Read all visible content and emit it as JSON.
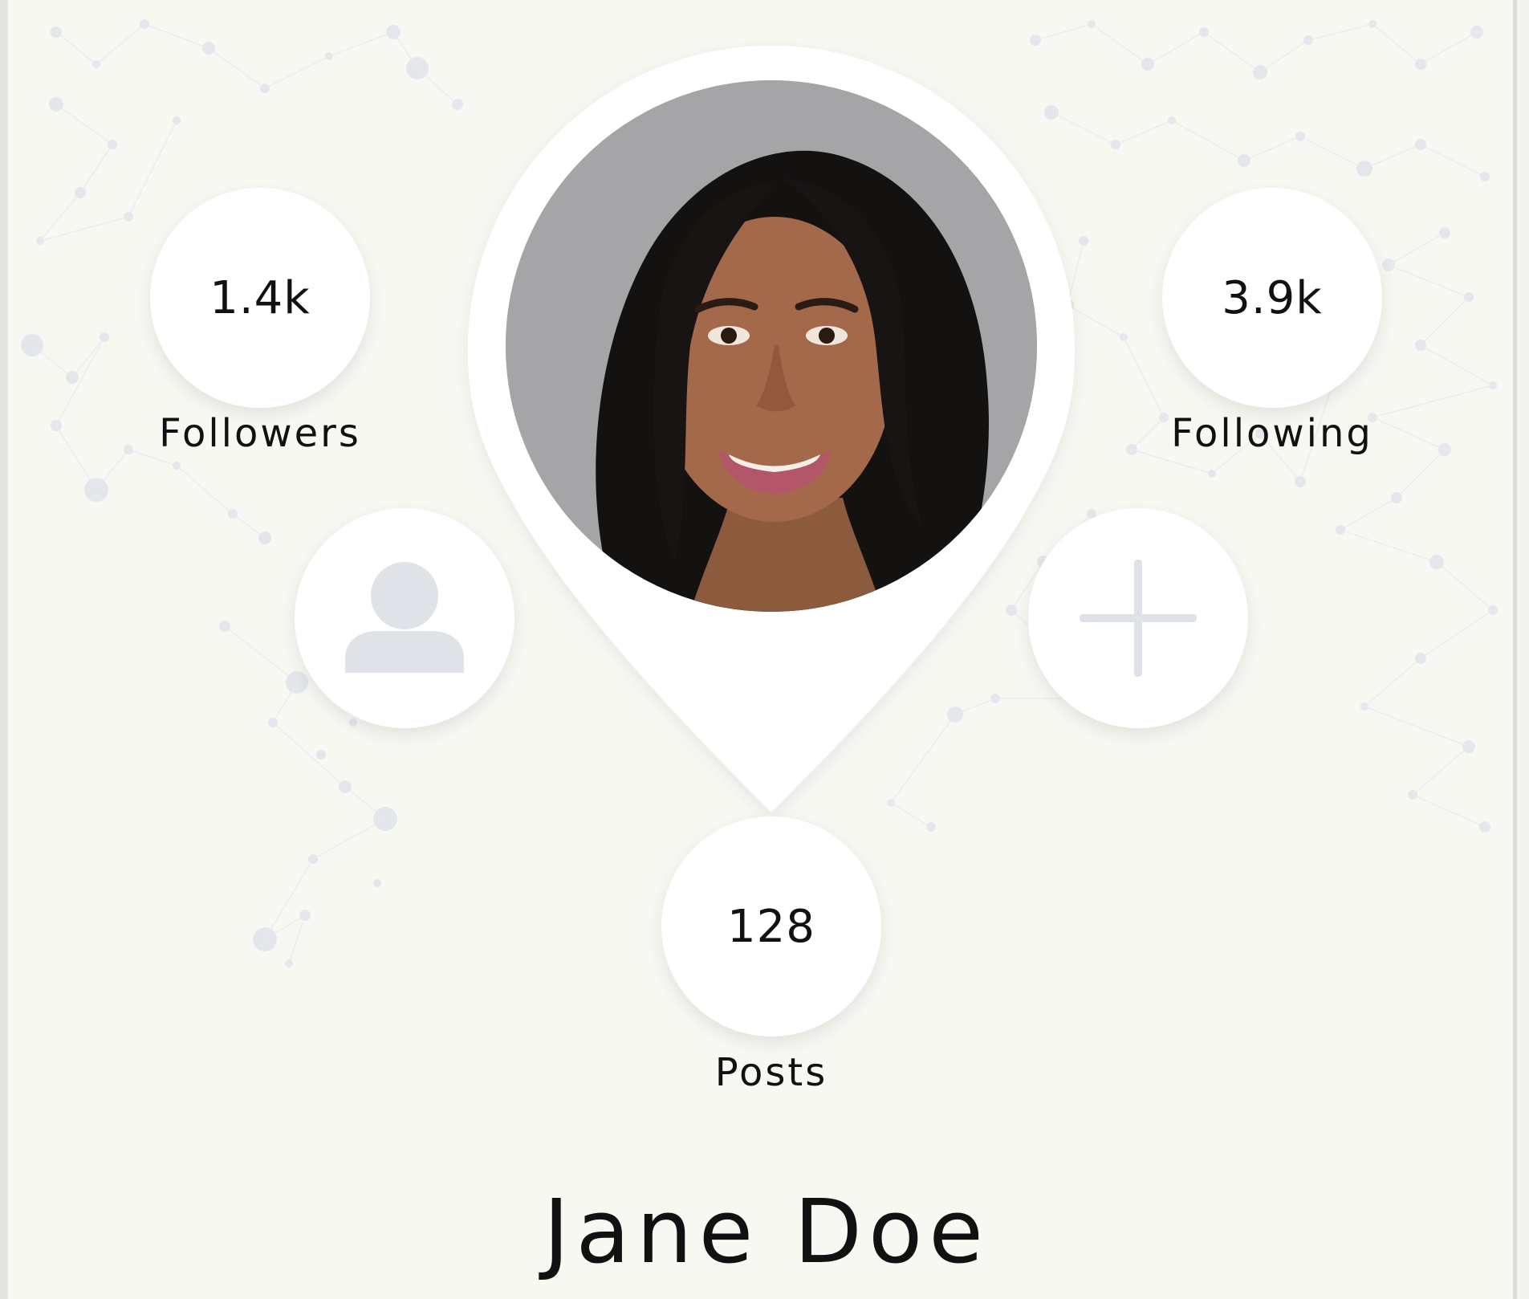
{
  "profile": {
    "name": "Jane Doe",
    "photo_alt": "Jane Doe profile photo"
  },
  "stats": {
    "followers": {
      "value": "1.4k",
      "label": "Followers"
    },
    "following": {
      "value": "3.9k",
      "label": "Following"
    },
    "posts": {
      "value": "128",
      "label": "Posts"
    }
  },
  "actions": {
    "profile_icon": "person-icon",
    "add_icon": "plus-icon"
  },
  "colors": {
    "background": "#f8f8f3",
    "surface": "#ffffff",
    "icon": "#dfe2e6",
    "text": "#111111"
  }
}
